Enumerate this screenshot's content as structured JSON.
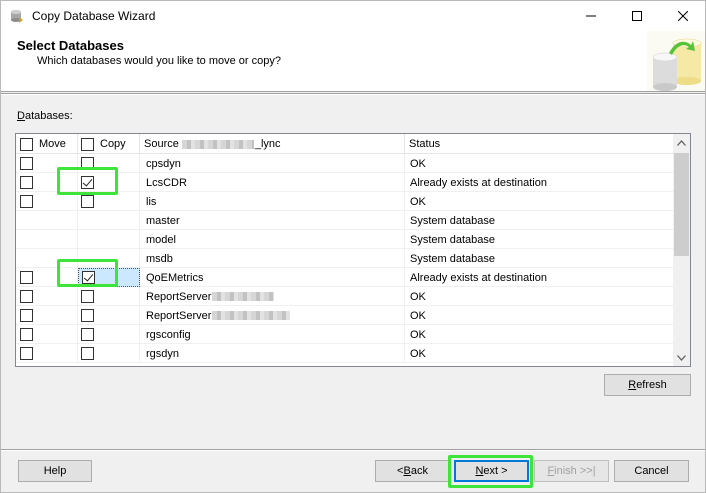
{
  "window": {
    "title": "Copy Database Wizard",
    "icons": {
      "app": "database-wizard-icon",
      "minimize": "minimize-icon",
      "maximize": "maximize-icon",
      "close": "close-icon"
    }
  },
  "banner": {
    "title": "Select Databases",
    "subtitle": "Which databases would you like to move or copy?",
    "art_icon": "database-cylinders-icon"
  },
  "databases_label": "Databases:",
  "grid": {
    "headers": {
      "move": "Move",
      "copy": "Copy",
      "source_prefix": "Source",
      "source_suffix": "_lync",
      "status": "Status"
    },
    "rows": [
      {
        "name": "cpsdyn",
        "status": "OK",
        "move_checked": false,
        "copy_checked": false,
        "checkboxes": true
      },
      {
        "name": "LcsCDR",
        "status": "Already exists at destination",
        "move_checked": false,
        "copy_checked": true,
        "checkboxes": true
      },
      {
        "name": "lis",
        "status": "OK",
        "move_checked": false,
        "copy_checked": false,
        "checkboxes": true
      },
      {
        "name": "master",
        "status": "System database",
        "checkboxes": false
      },
      {
        "name": "model",
        "status": "System database",
        "checkboxes": false
      },
      {
        "name": "msdb",
        "status": "System database",
        "checkboxes": false
      },
      {
        "name": "QoEMetrics",
        "status": "Already exists at destination",
        "move_checked": false,
        "copy_checked": true,
        "checkboxes": true,
        "selected": true
      },
      {
        "name": "ReportServer",
        "status": "OK",
        "move_checked": false,
        "copy_checked": false,
        "checkboxes": true,
        "redacted_suffix": true
      },
      {
        "name": "ReportServer",
        "status": "OK",
        "move_checked": false,
        "copy_checked": false,
        "checkboxes": true,
        "redacted_suffix": true
      },
      {
        "name": "rgsconfig",
        "status": "OK",
        "move_checked": false,
        "copy_checked": false,
        "checkboxes": true
      },
      {
        "name": "rgsdyn",
        "status": "OK",
        "move_checked": false,
        "copy_checked": false,
        "checkboxes": true
      }
    ]
  },
  "buttons": {
    "refresh": "Refresh",
    "help": "Help",
    "back": "< Back",
    "next": "Next >",
    "finish": "Finish >>|",
    "cancel": "Cancel"
  },
  "colors": {
    "highlight": "#3ee43a",
    "selection": "#cce8ff",
    "default_button_border": "#0078d7"
  }
}
